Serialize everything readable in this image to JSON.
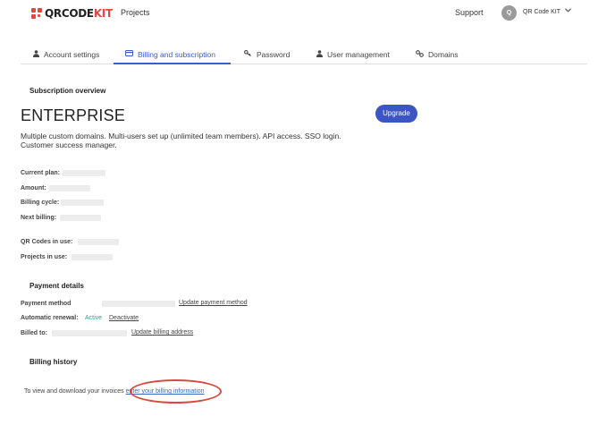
{
  "header": {
    "logo_text_main": "QRCODE",
    "logo_text_accent": "KIT",
    "nav_projects": "Projects",
    "nav_support": "Support",
    "avatar_initial": "Q",
    "user_name": "QR Code KIT",
    "user_menu_icon": "chevron-down-icon"
  },
  "tabs": [
    {
      "label": "Account settings",
      "icon": "user-icon",
      "active": false
    },
    {
      "label": "Billing and subscription",
      "icon": "credit-card-icon",
      "active": true
    },
    {
      "label": "Password",
      "icon": "key-icon",
      "active": false
    },
    {
      "label": "User management",
      "icon": "user-icon",
      "active": false
    },
    {
      "label": "Domains",
      "icon": "link-icon",
      "active": false
    }
  ],
  "subscription": {
    "heading": "Subscription overview",
    "plan_name": "ENTERPRISE",
    "plan_description": "Multiple custom domains. Multi-users set up (unlimited team members). API access. SSO login. Customer success manager.",
    "upgrade_label": "Upgrade",
    "current_plan_label": "Current plan:",
    "amount_label": "Amount:",
    "billing_cycle_label": "Billing cycle:",
    "next_billing_label": "Next billing:",
    "qr_codes_label": "QR Codes in use:",
    "projects_label": "Projects in use:"
  },
  "payment": {
    "heading": "Payment details",
    "method_label": "Payment method",
    "update_method_link": "Update payment method",
    "renewal_label": "Automatic renewal:",
    "renewal_status": "Active",
    "deactivate_link": "Deactivate",
    "billed_to_label": "Billed to:",
    "update_address_link": "Update billing address"
  },
  "history": {
    "heading": "Billing history",
    "text": "To view and download your invoices",
    "link": "enter your billing information"
  },
  "colors": {
    "accent": "#3a5fc8",
    "brand_red": "#e8453c",
    "active_green": "#2fa88a",
    "highlight_ring": "#d7483f"
  }
}
